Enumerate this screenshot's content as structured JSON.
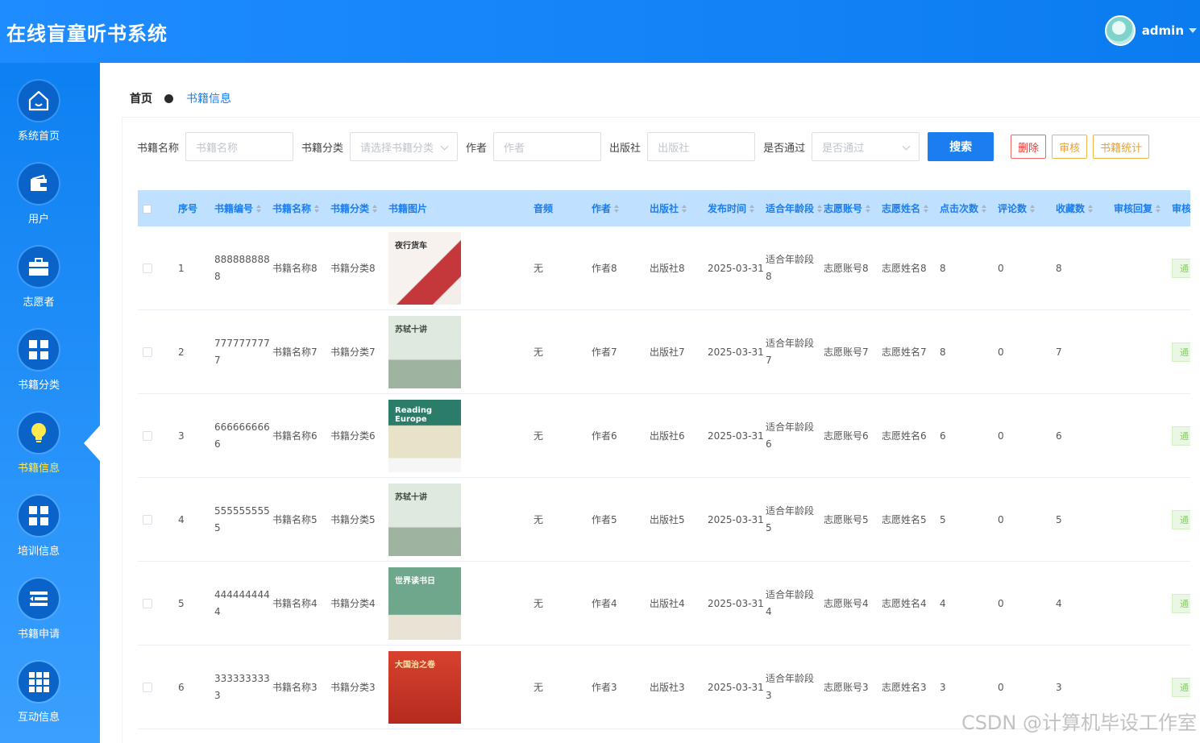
{
  "app": {
    "title": "在线盲童听书系统"
  },
  "user": {
    "name": "admin"
  },
  "sidebar": {
    "items": [
      {
        "label": "系统首页",
        "icon": "home-icon"
      },
      {
        "label": "用户",
        "icon": "wallet-icon"
      },
      {
        "label": "志愿者",
        "icon": "briefcase-icon"
      },
      {
        "label": "书籍分类",
        "icon": "grid-icon"
      },
      {
        "label": "书籍信息",
        "icon": "lightbulb-icon",
        "active": true
      },
      {
        "label": "培训信息",
        "icon": "grid-icon"
      },
      {
        "label": "书籍申请",
        "icon": "list-icon"
      },
      {
        "label": "互动信息",
        "icon": "apps-icon"
      }
    ]
  },
  "breadcrumb": {
    "home": "首页",
    "current": "书籍信息"
  },
  "search": {
    "book_name_label": "书籍名称",
    "book_name_placeholder": "书籍名称",
    "category_label": "书籍分类",
    "category_placeholder": "请选择书籍分类",
    "author_label": "作者",
    "author_placeholder": "作者",
    "publisher_label": "出版社",
    "publisher_placeholder": "出版社",
    "approved_label": "是否通过",
    "approved_placeholder": "是否通过",
    "search_button": "搜索",
    "delete_button": "删除",
    "audit_button": "审核",
    "stats_button": "书籍统计"
  },
  "table": {
    "headers": {
      "index": "序号",
      "code": "书籍编号",
      "name": "书籍名称",
      "category": "书籍分类",
      "image": "书籍图片",
      "audio": "音频",
      "author": "作者",
      "publisher": "出版社",
      "publish_time": "发布时间",
      "age": "适合年龄段",
      "vol_account": "志愿账号",
      "vol_name": "志愿姓名",
      "clicks": "点击次数",
      "comments": "评论数",
      "favorites": "收藏数",
      "audit_reply": "审核回复",
      "audit_status": "审核"
    },
    "rows": [
      {
        "index": "1",
        "code_line1": "888888888",
        "code_line2": "8",
        "name": "书籍名称8",
        "category": "书籍分类8",
        "audio": "无",
        "author": "作者8",
        "publisher": "出版社8",
        "publish_time": "2025-03-31",
        "age_line1": "适合年龄段",
        "age_line2": "8",
        "vol_account": "志愿账号8",
        "vol_name": "志愿姓名8",
        "clicks": "8",
        "comments": "0",
        "favorites": "8",
        "status": "通",
        "cover_title": "夜行货车"
      },
      {
        "index": "2",
        "code_line1": "777777777",
        "code_line2": "7",
        "name": "书籍名称7",
        "category": "书籍分类7",
        "audio": "无",
        "author": "作者7",
        "publisher": "出版社7",
        "publish_time": "2025-03-31",
        "age_line1": "适合年龄段",
        "age_line2": "7",
        "vol_account": "志愿账号7",
        "vol_name": "志愿姓名7",
        "clicks": "8",
        "comments": "0",
        "favorites": "7",
        "status": "通",
        "cover_title": "苏轼十讲"
      },
      {
        "index": "3",
        "code_line1": "666666666",
        "code_line2": "6",
        "name": "书籍名称6",
        "category": "书籍分类6",
        "audio": "无",
        "author": "作者6",
        "publisher": "出版社6",
        "publish_time": "2025-03-31",
        "age_line1": "适合年龄段",
        "age_line2": "6",
        "vol_account": "志愿账号6",
        "vol_name": "志愿姓名6",
        "clicks": "6",
        "comments": "0",
        "favorites": "6",
        "status": "通",
        "cover_title": "Reading Europe"
      },
      {
        "index": "4",
        "code_line1": "555555555",
        "code_line2": "5",
        "name": "书籍名称5",
        "category": "书籍分类5",
        "audio": "无",
        "author": "作者5",
        "publisher": "出版社5",
        "publish_time": "2025-03-31",
        "age_line1": "适合年龄段",
        "age_line2": "5",
        "vol_account": "志愿账号5",
        "vol_name": "志愿姓名5",
        "clicks": "5",
        "comments": "0",
        "favorites": "5",
        "status": "通",
        "cover_title": "苏轼十讲"
      },
      {
        "index": "5",
        "code_line1": "444444444",
        "code_line2": "4",
        "name": "书籍名称4",
        "category": "书籍分类4",
        "audio": "无",
        "author": "作者4",
        "publisher": "出版社4",
        "publish_time": "2025-03-31",
        "age_line1": "适合年龄段",
        "age_line2": "4",
        "vol_account": "志愿账号4",
        "vol_name": "志愿姓名4",
        "clicks": "4",
        "comments": "0",
        "favorites": "4",
        "status": "通",
        "cover_title": "世界读书日"
      },
      {
        "index": "6",
        "code_line1": "333333333",
        "code_line2": "3",
        "name": "书籍名称3",
        "category": "书籍分类3",
        "audio": "无",
        "author": "作者3",
        "publisher": "出版社3",
        "publish_time": "2025-03-31",
        "age_line1": "适合年龄段",
        "age_line2": "3",
        "vol_account": "志愿账号3",
        "vol_name": "志愿姓名3",
        "clicks": "3",
        "comments": "0",
        "favorites": "3",
        "status": "通",
        "cover_title": "大国治之卷"
      }
    ]
  },
  "watermark": "CSDN @计算机毕设工作室",
  "colors": {
    "primary": "#1a7ef0",
    "sidebar": "#1e8cff",
    "header_bg": "#bfe0ff",
    "active_label": "#ffe94d"
  }
}
